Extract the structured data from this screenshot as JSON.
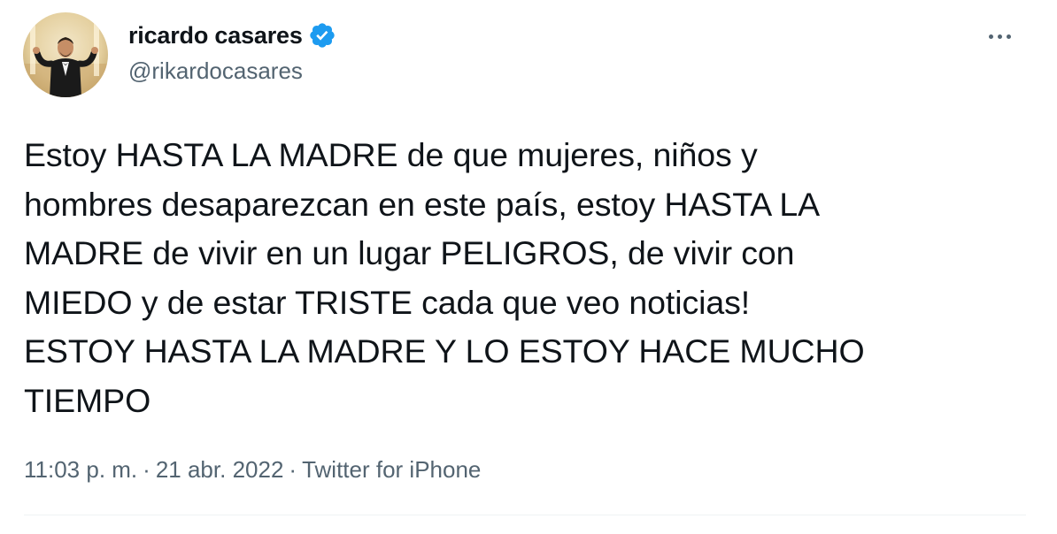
{
  "author": {
    "display_name": "ricardo casares",
    "handle": "@rikardocasares",
    "verified": true,
    "avatar_icon": "profile-photo"
  },
  "more_icon": "ellipsis-icon",
  "tweet": {
    "text": "Estoy HASTA LA MADRE de que mujeres, niños y\nhombres desaparezcan en este país, estoy HASTA LA\nMADRE de vivir en un lugar PELIGROS, de vivir con\nMIEDO y de estar TRISTE cada que veo noticias!\nESTOY HASTA LA MADRE Y LO ESTOY HACE MUCHO\nTIEMPO"
  },
  "meta": {
    "time": "11:03 p. m.",
    "separator": "·",
    "date": "21 abr. 2022",
    "source": "Twitter for iPhone"
  },
  "colors": {
    "text": "#0f1419",
    "secondary": "#536471",
    "verified_badge": "#1d9bf0",
    "divider": "#eff3f4"
  }
}
